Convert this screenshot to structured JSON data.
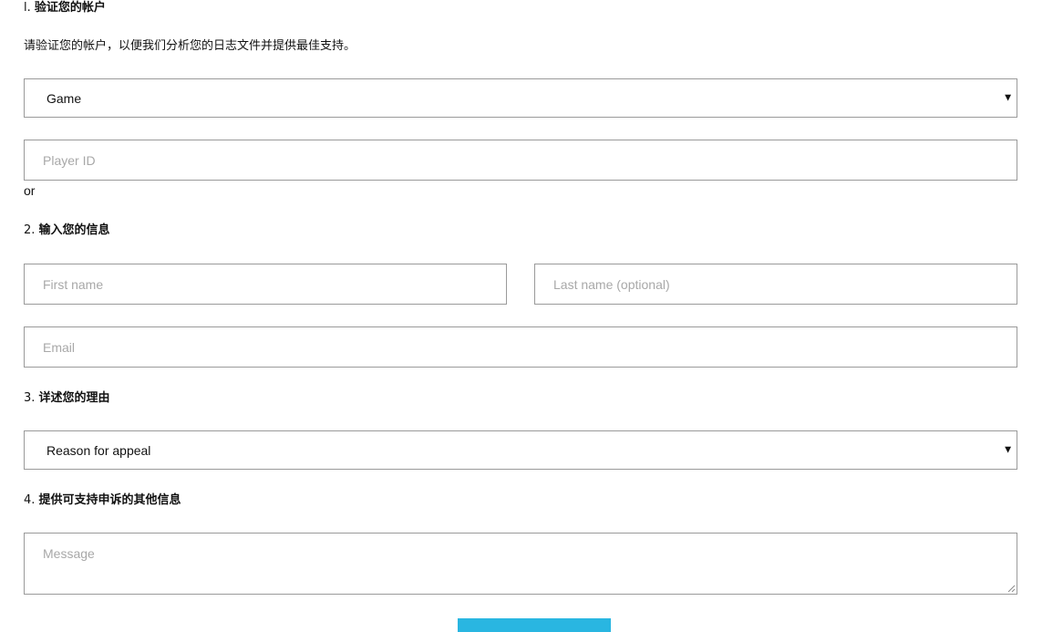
{
  "step1": {
    "number": "l.",
    "title": "验证您的帐户",
    "intro": "请验证您的帐户，以便我们分析您的日志文件并提供最佳支持。",
    "game_select": {
      "value": "Game"
    },
    "player_id": {
      "placeholder": "Player ID"
    },
    "or_text": "or"
  },
  "step2": {
    "number": "2.",
    "title": "输入您的信息",
    "first_name": {
      "placeholder": "First name"
    },
    "last_name": {
      "placeholder": "Last name (optional)"
    },
    "email": {
      "placeholder": "Email"
    }
  },
  "step3": {
    "number": "3.",
    "title": "详述您的理由",
    "reason_select": {
      "value": "Reason for appeal"
    }
  },
  "step4": {
    "number": "4.",
    "title": "提供可支持申诉的其他信息",
    "message": {
      "placeholder": "Message"
    }
  },
  "colors": {
    "accent": "#29b6e1",
    "border": "#9a9a9a",
    "placeholder": "#a8a8a8"
  },
  "icons": {
    "select_arrow": "dropdown-arrow-icon",
    "resize": "resize-handle-icon"
  }
}
